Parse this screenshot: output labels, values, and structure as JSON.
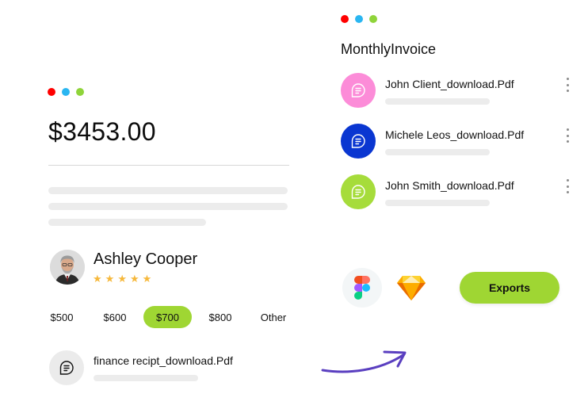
{
  "colors": {
    "dot_red": "#ff0000",
    "dot_blue": "#2ab6f1",
    "dot_green": "#8fd43a",
    "accent_green": "#9fd633",
    "pink": "#fc8cd8",
    "navy": "#0a36d1",
    "lime": "#a6dc3b",
    "star": "#f6b83b",
    "arrow": "#5a3fc0"
  },
  "payment_card": {
    "amount": "$3453.00",
    "user": {
      "name": "Ashley Cooper",
      "rating": 5
    },
    "amount_options": [
      "$500",
      "$600",
      "$700",
      "$800",
      "Other"
    ],
    "selected_option": "$700",
    "receipt_file": {
      "name": "finance recipt_download.Pdf",
      "icon": "document-icon"
    }
  },
  "invoice_panel": {
    "title": "MonthlyInvoice",
    "files": [
      {
        "name": "John Client_download.Pdf",
        "icon": "document-icon",
        "color": "#fc8cd8"
      },
      {
        "name": "Michele Leos_download.Pdf",
        "icon": "document-icon",
        "color": "#0a36d1"
      },
      {
        "name": "John Smith_download.Pdf",
        "icon": "document-icon",
        "color": "#a6dc3b"
      }
    ],
    "apps": [
      {
        "icon": "figma-icon"
      },
      {
        "icon": "sketch-icon"
      }
    ],
    "export_label": "Exports"
  }
}
